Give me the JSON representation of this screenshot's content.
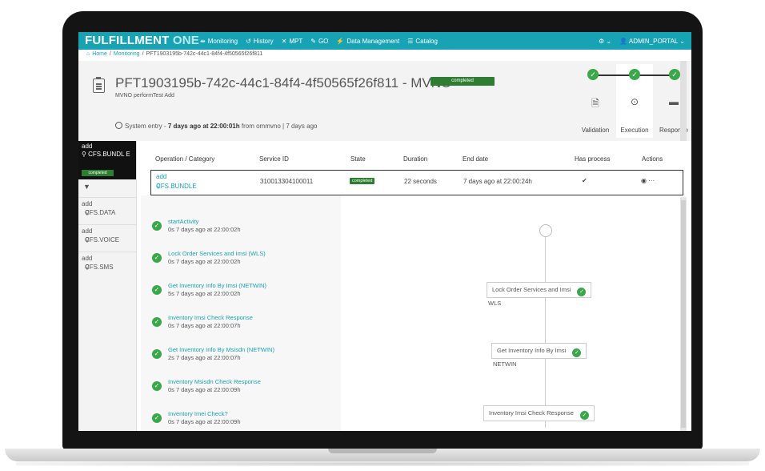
{
  "nav": {
    "logo_main": "FULFILLMENT",
    "logo_sub": "ONE",
    "items": [
      {
        "icon": "⇹",
        "label": "Monitoring"
      },
      {
        "icon": "↺",
        "label": "History"
      },
      {
        "icon": "✕",
        "label": "MPT"
      },
      {
        "icon": "✎",
        "label": "GO"
      },
      {
        "icon": "⚡",
        "label": "Data Management"
      },
      {
        "icon": "☰",
        "label": "Catalog"
      }
    ],
    "settings_icon": "⚙ ⌄",
    "user": "ADMIN_PORTAL ⌄"
  },
  "breadcrumb": {
    "home": "Home",
    "monitoring": "Monitoring",
    "current": "PFT1903195b-742c-44c1-84f4-4f50565f26f811"
  },
  "header": {
    "title": "PFT1903195b-742c-44c1-84f4-4f50565f26f811 - MVNO",
    "status": "completed",
    "subtitle": "MVNO performTest Add",
    "entry_prefix": "System entry -",
    "entry_bold": "7 days ago at 22:00:01h",
    "entry_from": "from",
    "entry_user": "ommvno",
    "entry_suffix": "| 7 days ago"
  },
  "steps": [
    {
      "label": "Validation",
      "icon": "document-icon"
    },
    {
      "label": "Execution",
      "icon": "play-icon"
    },
    {
      "label": "Response",
      "icon": "comment-icon"
    }
  ],
  "sidebar": {
    "active": {
      "op": "add",
      "name": "CFS.BUNDL E",
      "status": "completed"
    },
    "items": [
      {
        "op": "add",
        "name": "CFS.DATA"
      },
      {
        "op": "add",
        "name": "CFS.VOICE"
      },
      {
        "op": "add",
        "name": "CFS.SMS"
      }
    ]
  },
  "table": {
    "headers": [
      "Operation / Category",
      "Service ID",
      "State",
      "Duration",
      "End date",
      "Has process",
      "Actions"
    ],
    "row": {
      "op": "add",
      "category": "CFS.BUNDLE",
      "service_id": "310013304100011",
      "state": "completed",
      "duration": "22 seconds",
      "end_date": "7 days ago at 22:00:24h",
      "has_process": "✔",
      "actions": "◉ ···"
    }
  },
  "activities": [
    {
      "name": "startActivity",
      "meta": "0s   7 days ago at 22:00:02h"
    },
    {
      "name": "Lock Order Services and Imsi (WLS)",
      "meta": "0s   7 days ago at 22:00:02h"
    },
    {
      "name": "Get Inventory Info By Imsi (NETWIN)",
      "meta": "5s   7 days ago at 22:00:02h"
    },
    {
      "name": "Inventory Imsi Check Response",
      "meta": "0s   7 days ago at 22:00:07h"
    },
    {
      "name": "Get Inventory Info By Msisdn (NETWIN)",
      "meta": "2s   7 days ago at 22:00:07h"
    },
    {
      "name": "Inventory Msisdn Check Response",
      "meta": "0s   7 days ago at 22:00:09h"
    },
    {
      "name": "Inventory Imei Check?",
      "meta": "0s   7 days ago at 22:00:09h"
    }
  ],
  "flow": {
    "nodes": [
      {
        "label": "Lock Order Services and Imsi",
        "tag": "WLS"
      },
      {
        "label": "Get Inventory Info By Imsi",
        "tag": "NETWIN"
      },
      {
        "label": "Inventory Imsi Check Response",
        "tag": ""
      }
    ]
  },
  "colors": {
    "accent": "#17a3b4",
    "success": "#3aa84a",
    "badge": "#2e7d32"
  }
}
